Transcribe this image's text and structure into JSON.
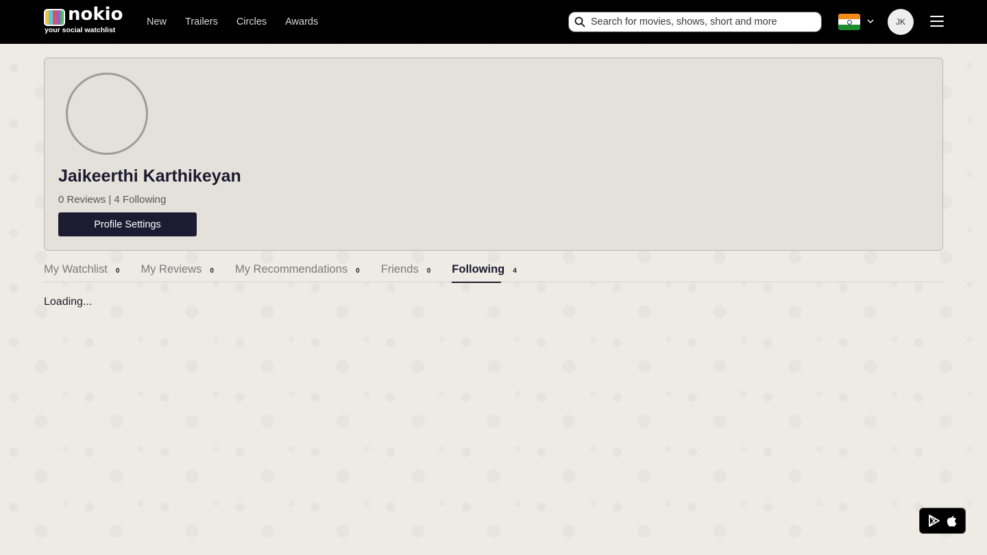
{
  "header": {
    "brand": "nokio",
    "tagline": "your social watchlist",
    "nav": [
      "New",
      "Trailers",
      "Circles",
      "Awards"
    ],
    "search_placeholder": "Search for movies, shows, short and more",
    "avatar_initials": "JK",
    "country_icon": "india-flag-icon"
  },
  "profile": {
    "name": "Jaikeerthi Karthikeyan",
    "stats": "0 Reviews | 4 Following",
    "settings_label": "Profile Settings"
  },
  "tabs": [
    {
      "label": "My Watchlist",
      "count": "0"
    },
    {
      "label": "My Reviews",
      "count": "0"
    },
    {
      "label": "My Recommendations",
      "count": "0"
    },
    {
      "label": "Friends",
      "count": "0"
    },
    {
      "label": "Following",
      "count": "4",
      "active": true
    }
  ],
  "content": {
    "status": "Loading..."
  },
  "colors": {
    "header_bg": "#000000",
    "page_bg": "#eeebe4",
    "accent": "#1d1b32"
  }
}
